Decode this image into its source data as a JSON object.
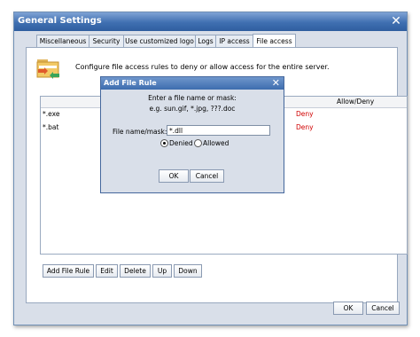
{
  "window": {
    "title": "General Settings"
  },
  "tabs": [
    {
      "label": "Miscellaneous"
    },
    {
      "label": "Security"
    },
    {
      "label": "Use customized logo"
    },
    {
      "label": "Logs"
    },
    {
      "label": "IP access"
    },
    {
      "label": "File access"
    }
  ],
  "panel": {
    "description": "Configure file access rules to deny or allow access for the entire server.",
    "list_header_allow": "Allow/Deny",
    "rows": [
      {
        "name": "*.exe",
        "action": "Deny"
      },
      {
        "name": "*.bat",
        "action": "Deny"
      }
    ],
    "buttons": {
      "add": "Add File Rule",
      "edit": "Edit",
      "delete": "Delete",
      "up": "Up",
      "down": "Down"
    }
  },
  "footer": {
    "ok": "OK",
    "cancel": "Cancel"
  },
  "dialog": {
    "title": "Add File Rule",
    "prompt1": "Enter a file name or mask:",
    "prompt2": "e.g. sun.gif, *.jpg, ???.doc",
    "field_label": "File name/mask:",
    "field_value": "*.dll",
    "radio_denied": "Denied",
    "radio_allowed": "Allowed",
    "ok": "OK",
    "cancel": "Cancel"
  },
  "colors": {
    "deny": "#d00000",
    "title_blue": "#3f6fb1"
  }
}
